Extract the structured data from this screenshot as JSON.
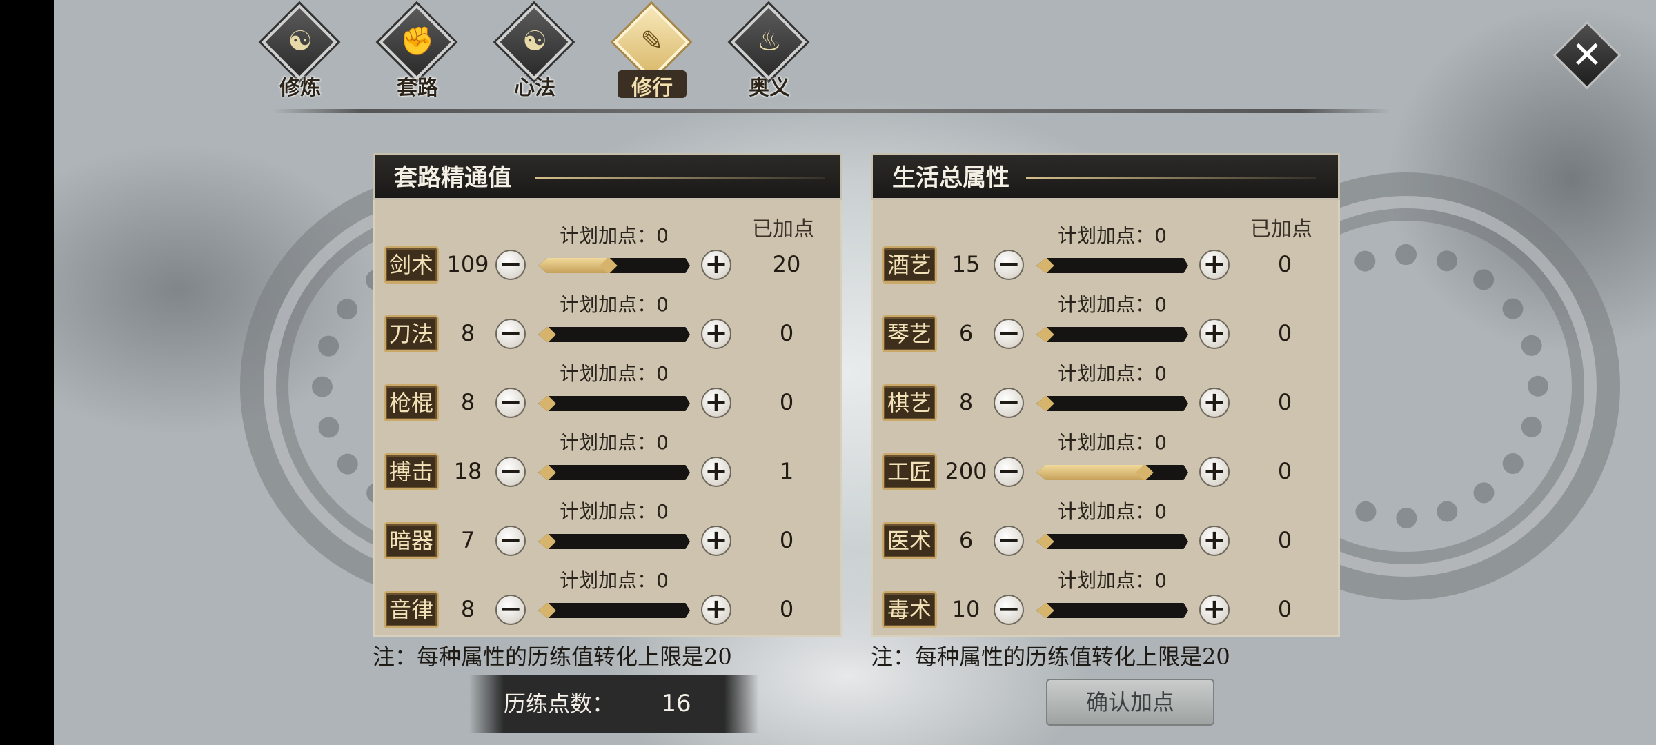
{
  "tabs": [
    {
      "label": "修炼",
      "icon": "swirl-icon",
      "active": false
    },
    {
      "label": "套路",
      "icon": "fist-icon",
      "active": false
    },
    {
      "label": "心法",
      "icon": "yin-yang-icon",
      "active": false
    },
    {
      "label": "修行",
      "icon": "scroll-icon",
      "active": true
    },
    {
      "label": "奥义",
      "icon": "flame-icon",
      "active": false
    }
  ],
  "close": {
    "icon": "close-icon"
  },
  "left_panel": {
    "title": "套路精通值",
    "added_header": "已加点",
    "note": "注：每种属性的历练值转化上限是20",
    "rows": [
      {
        "name": "剑术",
        "base": "109",
        "plan": "计划加点：0",
        "added": "20",
        "fill": 0.45
      },
      {
        "name": "刀法",
        "base": "8",
        "plan": "计划加点：0",
        "added": "0",
        "fill": 0.0
      },
      {
        "name": "枪棍",
        "base": "8",
        "plan": "计划加点：0",
        "added": "0",
        "fill": 0.0
      },
      {
        "name": "搏击",
        "base": "18",
        "plan": "计划加点：0",
        "added": "1",
        "fill": 0.0
      },
      {
        "name": "暗器",
        "base": "7",
        "plan": "计划加点：0",
        "added": "0",
        "fill": 0.0
      },
      {
        "name": "音律",
        "base": "8",
        "plan": "计划加点：0",
        "added": "0",
        "fill": 0.0
      }
    ]
  },
  "right_panel": {
    "title": "生活总属性",
    "added_header": "已加点",
    "note": "注：每种属性的历练值转化上限是20",
    "rows": [
      {
        "name": "酒艺",
        "base": "15",
        "plan": "计划加点：0",
        "added": "0",
        "fill": 0.0
      },
      {
        "name": "琴艺",
        "base": "6",
        "plan": "计划加点：0",
        "added": "0",
        "fill": 0.0
      },
      {
        "name": "棋艺",
        "base": "8",
        "plan": "计划加点：0",
        "added": "0",
        "fill": 0.0
      },
      {
        "name": "工匠",
        "base": "200",
        "plan": "计划加点：0",
        "added": "0",
        "fill": 0.7
      },
      {
        "name": "医术",
        "base": "6",
        "plan": "计划加点：0",
        "added": "0",
        "fill": 0.0
      },
      {
        "name": "毒术",
        "base": "10",
        "plan": "计划加点：0",
        "added": "0",
        "fill": 0.0
      }
    ]
  },
  "buttons": {
    "minus": "−",
    "plus": "+"
  },
  "points": {
    "label": "历练点数：",
    "value": "16"
  },
  "confirm": {
    "label": "确认加点"
  }
}
